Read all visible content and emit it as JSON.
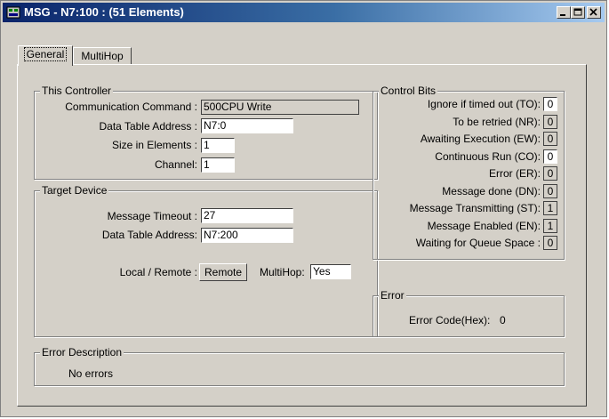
{
  "window": {
    "title": "MSG - N7:100 : (51 Elements)",
    "icon": "msg-instruction-icon",
    "minimize_icon": "minimize-icon",
    "maximize_icon": "maximize-icon",
    "close_icon": "close-icon"
  },
  "tabs": [
    {
      "label": "General",
      "active": true
    },
    {
      "label": "MultiHop",
      "active": false
    }
  ],
  "this_controller": {
    "title": "This Controller",
    "comm_command_label": "Communication Command :",
    "comm_command_value": "500CPU Write",
    "dta_label": "Data Table Address :",
    "dta_value": "N7:0",
    "size_label": "Size in Elements :",
    "size_value": "1",
    "channel_label": "Channel:",
    "channel_value": "1"
  },
  "target_device": {
    "title": "Target Device",
    "timeout_label": "Message Timeout :",
    "timeout_value": "27",
    "dta_label": "Data Table Address:",
    "dta_value": "N7:200",
    "local_remote_label": "Local / Remote :",
    "local_remote_button": "Remote",
    "multihop_label": "MultiHop:",
    "multihop_value": "Yes"
  },
  "control_bits": {
    "title": "Control Bits",
    "bits": [
      {
        "label": "Ignore if timed out (TO):",
        "value": "0",
        "shaded": false
      },
      {
        "label": "To be retried (NR):",
        "value": "0",
        "shaded": true
      },
      {
        "label": "Awaiting Execution (EW):",
        "value": "0",
        "shaded": true
      },
      {
        "label": "Continuous Run (CO):",
        "value": "0",
        "shaded": false
      },
      {
        "label": "Error (ER):",
        "value": "0",
        "shaded": true
      },
      {
        "label": "Message done (DN):",
        "value": "0",
        "shaded": true
      },
      {
        "label": "Message Transmitting (ST):",
        "value": "1",
        "shaded": true
      },
      {
        "label": "Message Enabled (EN):",
        "value": "1",
        "shaded": true
      },
      {
        "label": "Waiting for Queue Space :",
        "value": "0",
        "shaded": true
      }
    ]
  },
  "error": {
    "title": "Error",
    "code_label": "Error Code(Hex):",
    "code_value": "0"
  },
  "error_description": {
    "title": "Error Description",
    "text": "No errors"
  }
}
